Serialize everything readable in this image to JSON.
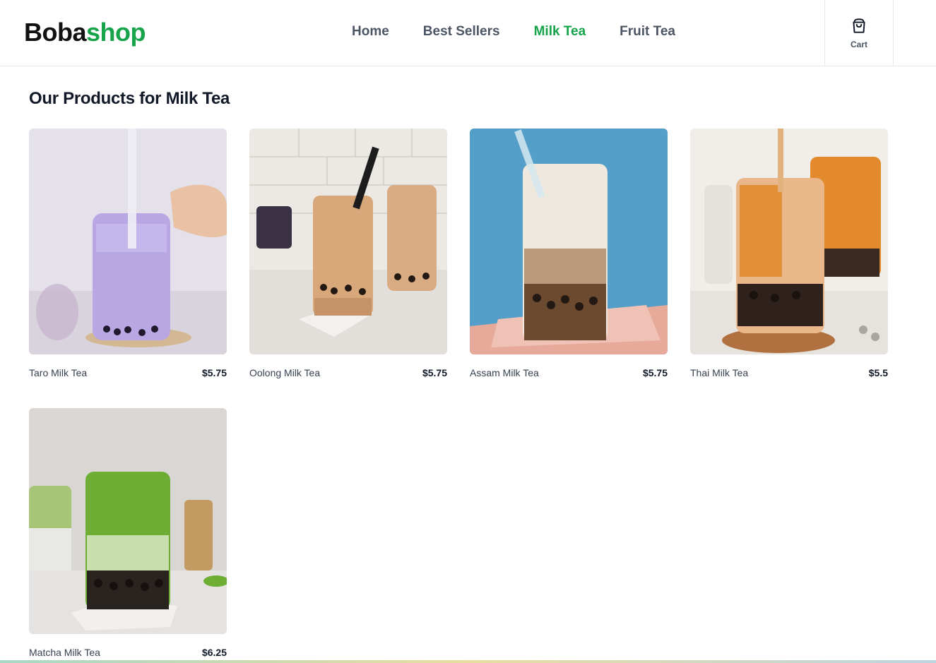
{
  "header": {
    "logo_part1": "Boba",
    "logo_part2": "shop",
    "brand_color": "#16a34a",
    "nav": [
      {
        "label": "Home",
        "active": false
      },
      {
        "label": "Best Sellers",
        "active": false
      },
      {
        "label": "Milk Tea",
        "active": true
      },
      {
        "label": "Fruit Tea",
        "active": false
      }
    ],
    "cart_label": "Cart",
    "cart_icon": "shopping-bag-icon"
  },
  "main": {
    "heading": "Our Products for Milk Tea",
    "products": [
      {
        "name": "Taro Milk Tea",
        "price": "$5.75"
      },
      {
        "name": "Oolong Milk Tea",
        "price": "$5.75"
      },
      {
        "name": "Assam Milk Tea",
        "price": "$5.75"
      },
      {
        "name": "Thai Milk Tea",
        "price": "$5.5"
      },
      {
        "name": "Matcha Milk Tea",
        "price": "$6.25"
      }
    ]
  }
}
